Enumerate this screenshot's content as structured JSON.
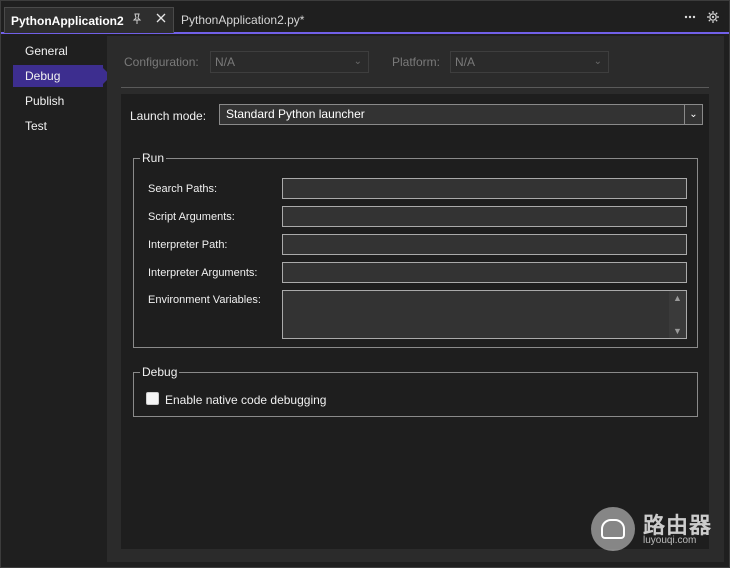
{
  "tabs": {
    "active_label": "PythonApplication2",
    "inactive_label": "PythonApplication2.py*"
  },
  "icons": {
    "pin": "pin-icon",
    "close": "close-icon",
    "more": "more-options-icon",
    "settings": "gear-icon"
  },
  "nav": {
    "items": [
      {
        "label": "General"
      },
      {
        "label": "Debug"
      },
      {
        "label": "Publish"
      },
      {
        "label": "Test"
      }
    ],
    "selected": "Debug"
  },
  "config": {
    "configuration_label": "Configuration:",
    "configuration_value": "N/A",
    "platform_label": "Platform:",
    "platform_value": "N/A"
  },
  "launch": {
    "label": "Launch mode:",
    "value": "Standard Python launcher"
  },
  "run": {
    "title": "Run",
    "fields": [
      {
        "label": "Search Paths:",
        "value": ""
      },
      {
        "label": "Script Arguments:",
        "value": ""
      },
      {
        "label": "Interpreter Path:",
        "value": ""
      },
      {
        "label": "Interpreter Arguments:",
        "value": ""
      },
      {
        "label": "Environment Variables:",
        "value": ""
      }
    ]
  },
  "debug": {
    "title": "Debug",
    "native_label": "Enable native code debugging",
    "native_checked": false
  },
  "watermark": {
    "title": "路由器",
    "subtitle": "luyouqi.com"
  },
  "colors": {
    "accent": "#7160e8",
    "nav_selected": "#3d2e8f"
  }
}
